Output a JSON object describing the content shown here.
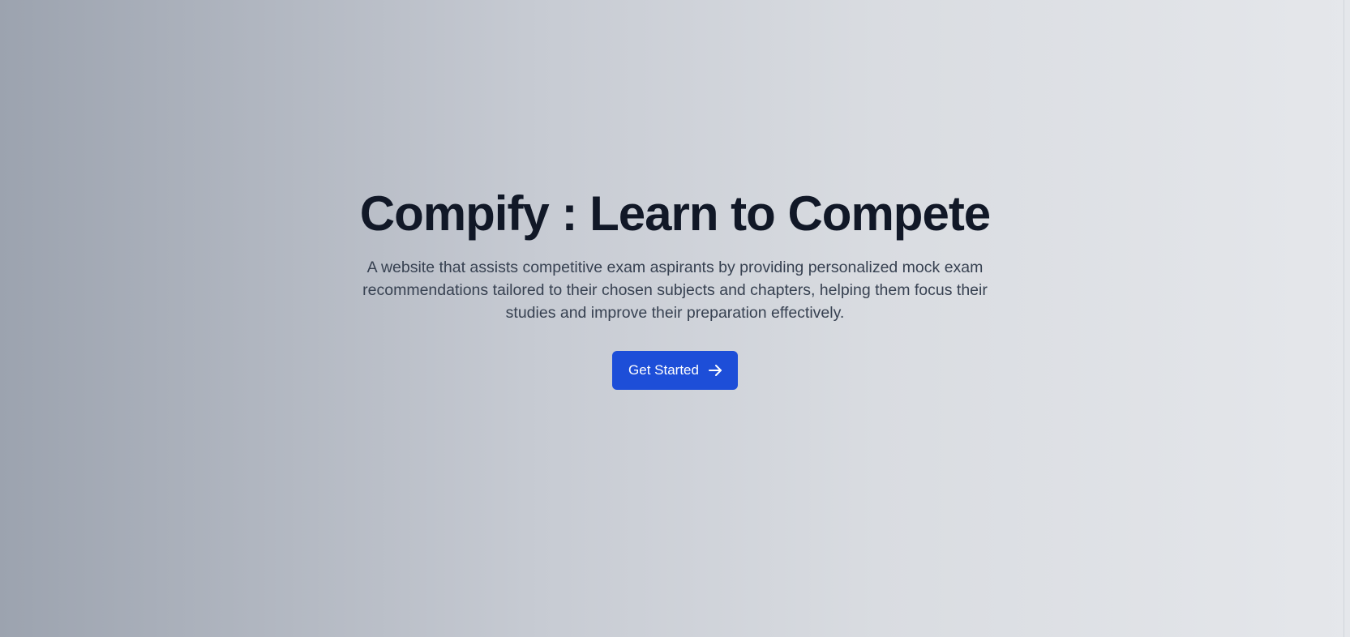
{
  "hero": {
    "title": "Compify : Learn to Compete",
    "description": "A website that assists competitive exam aspirants by providing personalized mock exam recommendations tailored to their chosen subjects and chapters, helping them focus their studies and improve their preparation effectively.",
    "cta_label": "Get Started",
    "cta_icon": "arrow-right-icon"
  },
  "colors": {
    "title": "#111827",
    "description": "#374151",
    "button_bg": "#1d4ed8",
    "button_text": "#ffffff",
    "gradient_start": "#9ca3af",
    "gradient_end": "#e5e7eb"
  }
}
